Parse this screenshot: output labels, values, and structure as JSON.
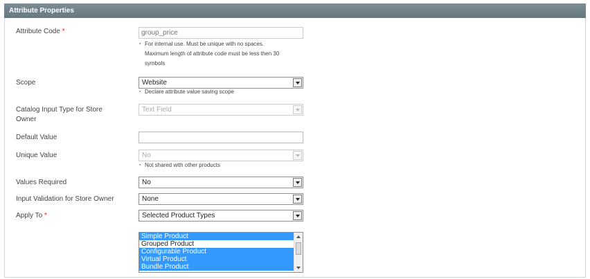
{
  "section": {
    "title": "Attribute Properties"
  },
  "attribute_code": {
    "label": "Attribute Code",
    "required_mark": "*",
    "placeholder": "group_price",
    "note_line1": "For internal use. Must be unique with no spaces.",
    "note_line2": "Maximum length of attribute code must be less then 30",
    "note_line3": "symbols"
  },
  "scope": {
    "label": "Scope",
    "value": "Website",
    "note": "Declare attribute value saving scope"
  },
  "catalog_input_type": {
    "label_line1": "Catalog Input Type for Store",
    "label_line2": "Owner",
    "value": "Text Field"
  },
  "default_value": {
    "label": "Default Value",
    "value": ""
  },
  "unique_value": {
    "label": "Unique Value",
    "value": "No",
    "note": "Not shared with other products"
  },
  "values_required": {
    "label": "Values Required",
    "value": "No"
  },
  "input_validation": {
    "label": "Input Validation for Store Owner",
    "value": "None"
  },
  "apply_to": {
    "label": "Apply To",
    "required_mark": "*",
    "value": "Selected Product Types",
    "options": [
      {
        "label": "Simple Product",
        "selected": true
      },
      {
        "label": "Grouped Product",
        "selected": false
      },
      {
        "label": "Configurable Product",
        "selected": true
      },
      {
        "label": "Virtual Product",
        "selected": true
      },
      {
        "label": "Bundle Product",
        "selected": true
      }
    ]
  },
  "icons": [
    "chevron-down-icon",
    "scroll-up-icon",
    "scroll-down-icon"
  ]
}
